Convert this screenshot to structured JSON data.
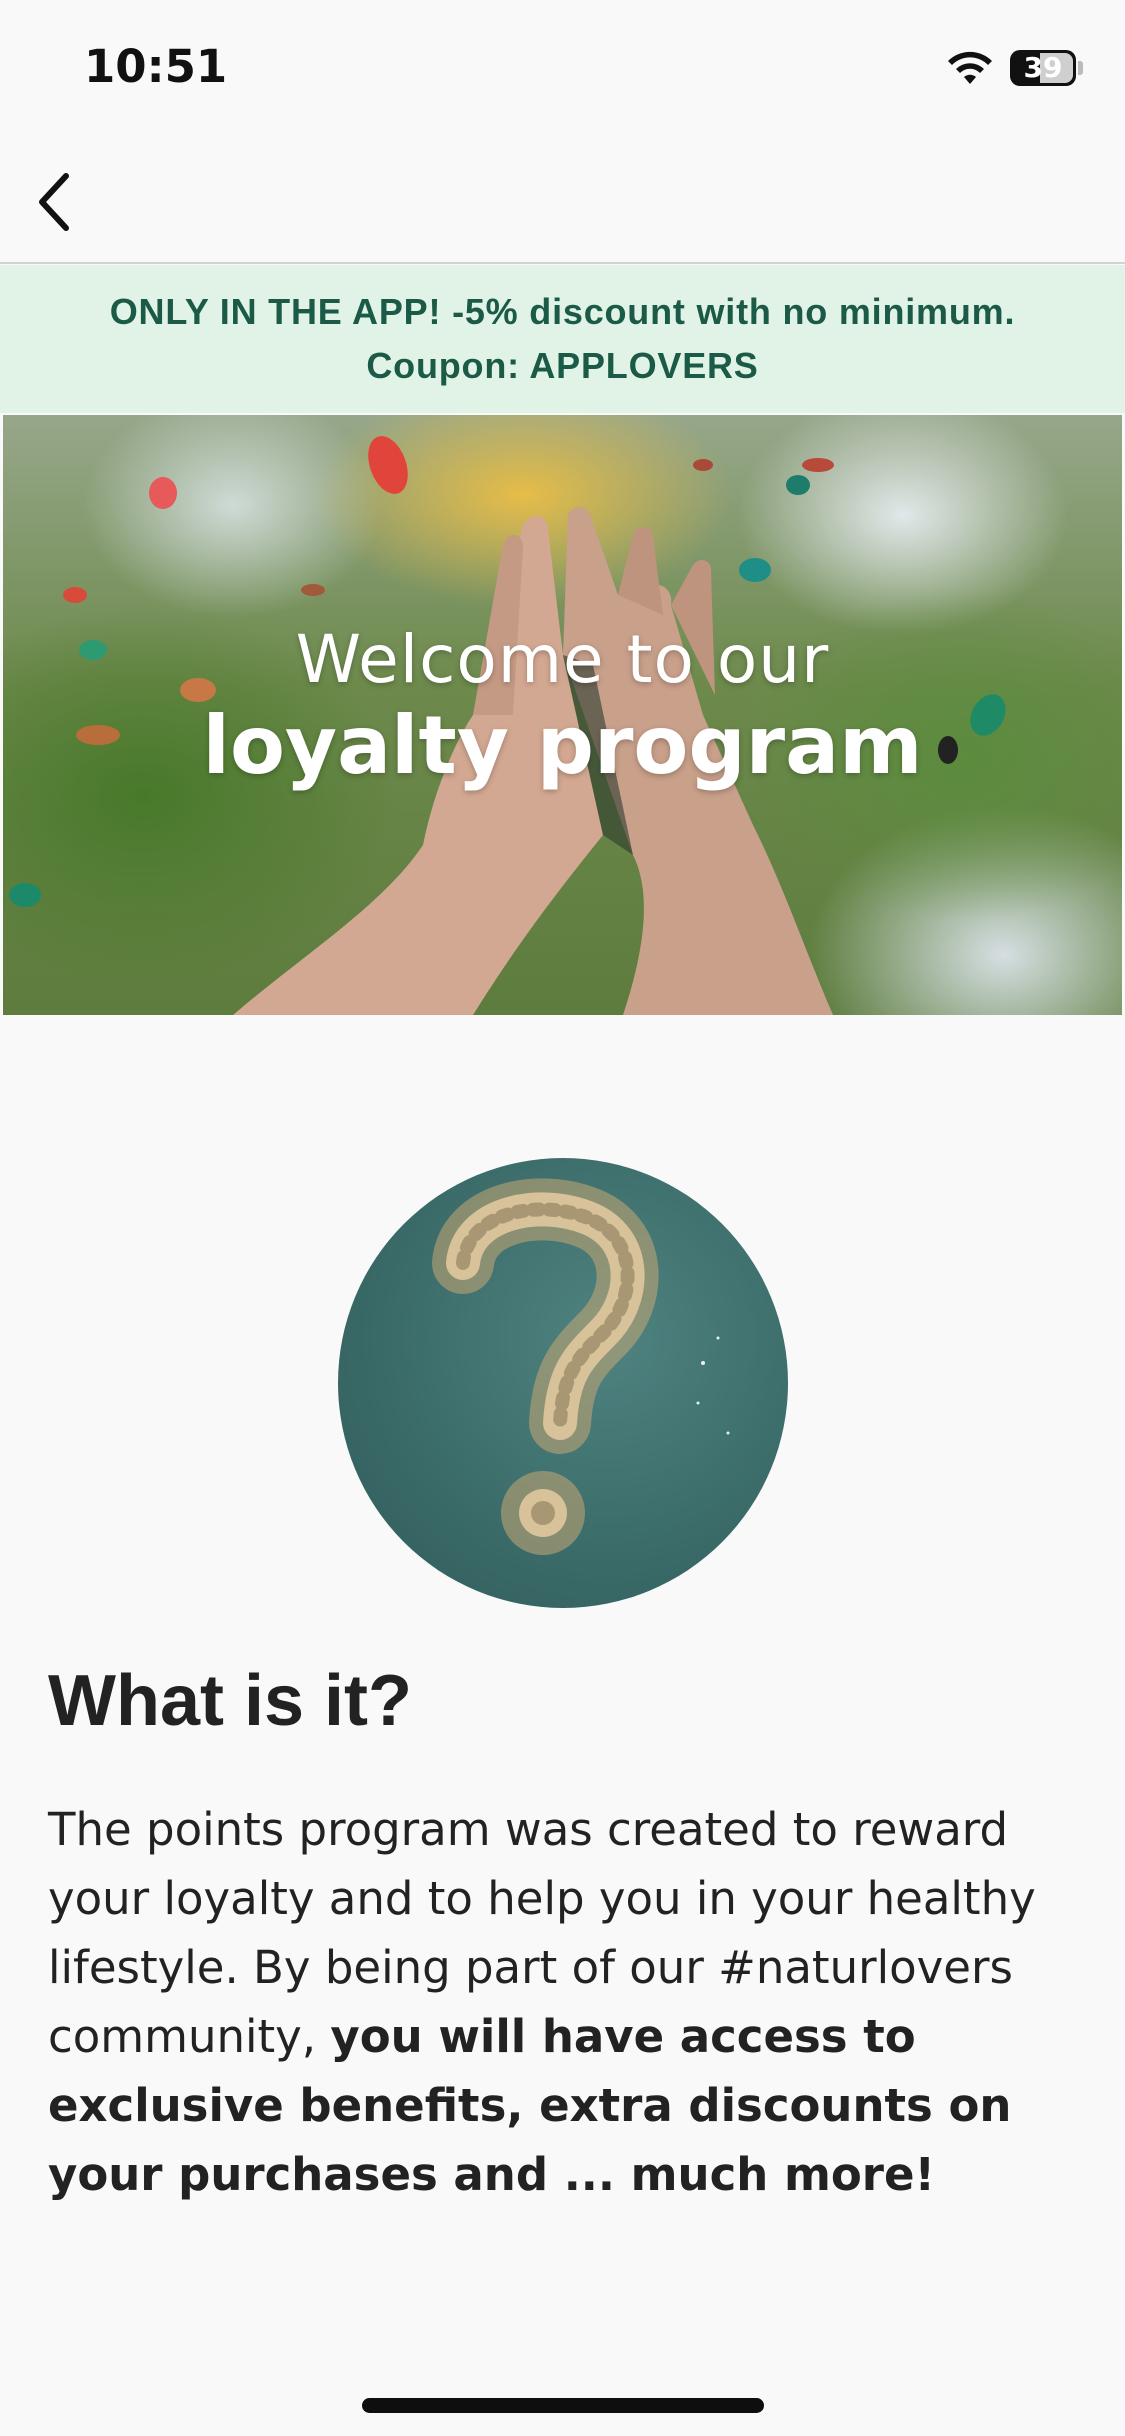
{
  "status_bar": {
    "time": "10:51",
    "battery": "39"
  },
  "nav": {
    "back_icon": "chevron-left-icon"
  },
  "promo": {
    "line1": "ONLY IN THE APP! -5% discount with no minimum.",
    "line2": "Coupon: APPLOVERS",
    "background_color": "#e1f2e7",
    "text_color": "#1c5a48"
  },
  "hero": {
    "line1": "Welcome to our",
    "line2": "loyalty program"
  },
  "section": {
    "title": "What is it?",
    "text_regular": "The points program was created to reward your loyalty and to help you in your healthy lifestyle. By being part of our #naturlovers community, ",
    "text_bold": "you will have access to exclusive benefits, extra discounts on your purchases and ... much more!"
  }
}
